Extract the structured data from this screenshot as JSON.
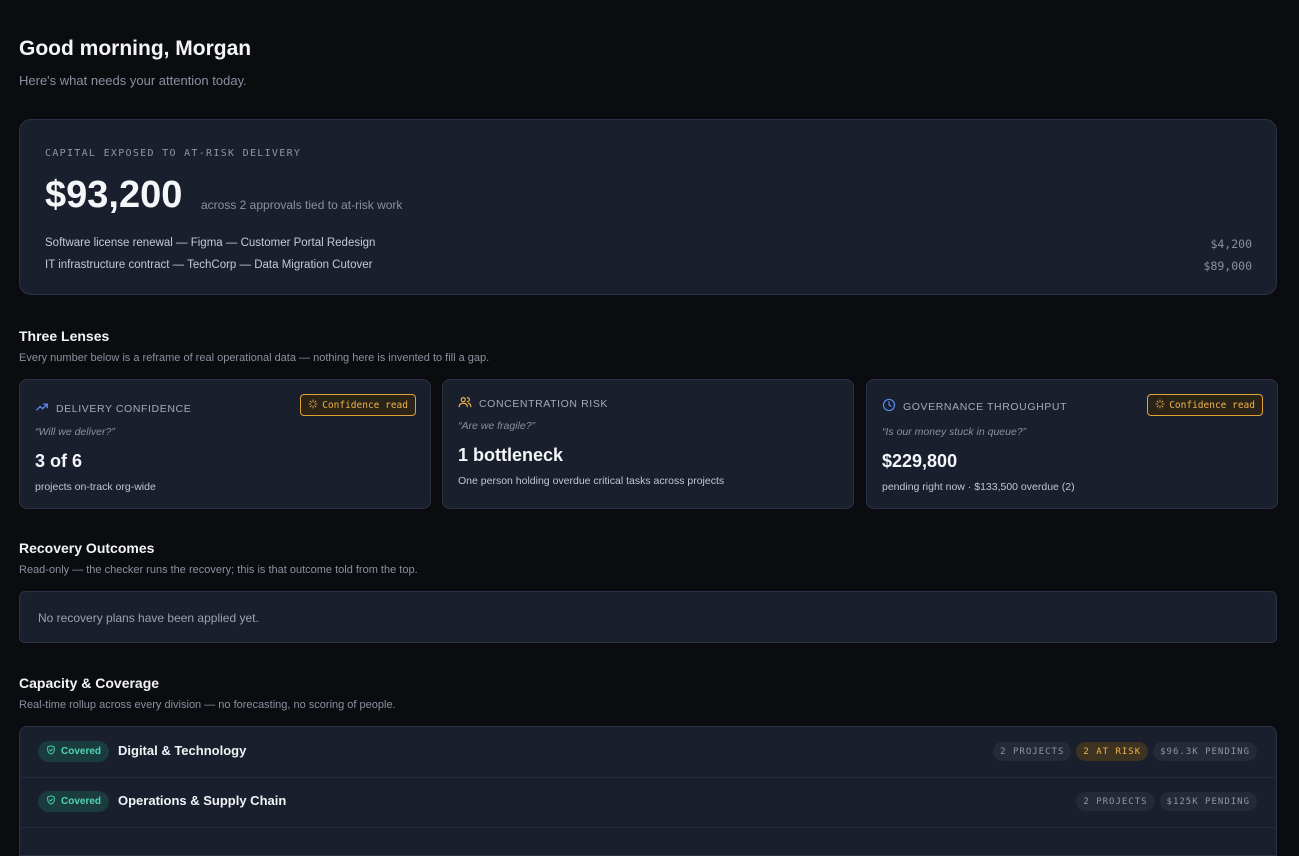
{
  "header": {
    "greeting": "Good morning, Morgan",
    "subtitle": "Here's what needs your attention today."
  },
  "capital": {
    "label": "CAPITAL EXPOSED TO AT-RISK DELIVERY",
    "amount": "$93,200",
    "caption": "across 2 approvals tied to at-risk work",
    "items": [
      {
        "label": "Software license renewal — Figma — Customer Portal Redesign",
        "amount": "$4,200"
      },
      {
        "label": "IT infrastructure contract — TechCorp — Data Migration Cutover",
        "amount": "$89,000"
      }
    ]
  },
  "lenses": {
    "title": "Three Lenses",
    "subtitle": "Every number below is a reframe of real operational data — nothing here is invented to fill a gap.",
    "cards": [
      {
        "icon": "trending-up-icon",
        "label": "DELIVERY CONFIDENCE",
        "badge": "Confidence read",
        "question": "“Will we deliver?”",
        "value": "3 of 6",
        "desc": "projects on-track org-wide"
      },
      {
        "icon": "users-icon",
        "label": "CONCENTRATION RISK",
        "question": "“Are we fragile?”",
        "value": "1 bottleneck",
        "desc": "One person holding overdue critical tasks across projects"
      },
      {
        "icon": "clock-icon",
        "label": "GOVERNANCE THROUGHPUT",
        "badge": "Confidence read",
        "question": "“Is our money stuck in queue?”",
        "value": "$229,800",
        "desc": "pending right now · $133,500 overdue (2)"
      }
    ]
  },
  "recovery": {
    "title": "Recovery Outcomes",
    "subtitle": "Read-only — the checker runs the recovery; this is that outcome told from the top.",
    "empty": "No recovery plans have been applied yet."
  },
  "coverage": {
    "title": "Capacity & Coverage",
    "subtitle": "Real-time rollup across every division — no forecasting, no scoring of people.",
    "rows": [
      {
        "status": "Covered",
        "name": "Digital & Technology",
        "projects": "2 PROJECTS",
        "at_risk": "2 AT RISK",
        "pending": "$96.3K PENDING"
      },
      {
        "status": "Covered",
        "name": "Operations & Supply Chain",
        "projects": "2 PROJECTS",
        "pending": "$125K PENDING"
      }
    ]
  },
  "colors": {
    "background": "#0b0c10",
    "card": "#1a1f2e",
    "accent_amber": "#f0b34a",
    "accent_teal": "#4fd4b7",
    "accent_blue": "#5b8cf5"
  }
}
